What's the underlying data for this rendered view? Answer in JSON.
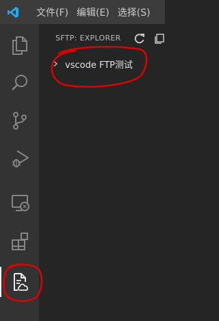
{
  "titlebar": {
    "menus": [
      "文件(F)",
      "编辑(E)",
      "选择(S)"
    ]
  },
  "activity_bar": {
    "items": [
      {
        "icon": "files-icon"
      },
      {
        "icon": "search-icon"
      },
      {
        "icon": "source-control-icon"
      },
      {
        "icon": "run-debug-icon"
      },
      {
        "icon": "remote-explorer-icon"
      },
      {
        "icon": "extensions-icon"
      },
      {
        "icon": "sftp-icon",
        "active": true
      }
    ]
  },
  "sidebar": {
    "title": "SFTP: EXPLORER",
    "tree": [
      {
        "label": "vscode FTP测试"
      }
    ]
  },
  "colors": {
    "titlebar": "#3c3c3c",
    "activity_bar": "#333333",
    "sidebar": "#252526",
    "logo": "#23a9f2",
    "annotation": "#e00000"
  }
}
